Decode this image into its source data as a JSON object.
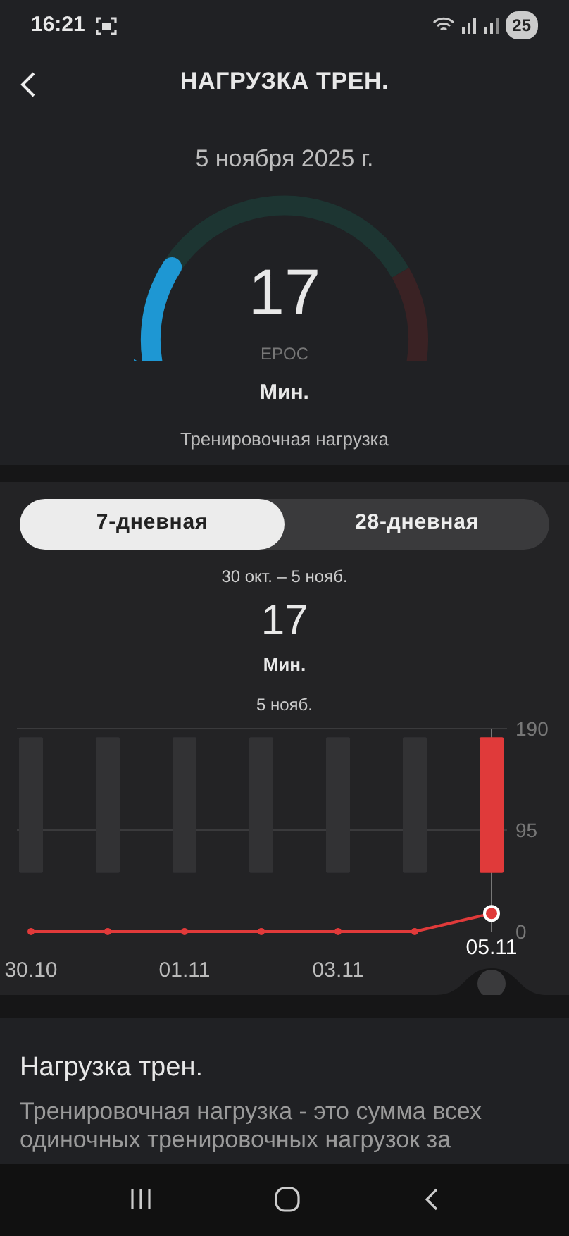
{
  "status_bar": {
    "time": "16:21",
    "battery": "25"
  },
  "header": {
    "title": "НАГРУЗКА ТРЕН."
  },
  "summary": {
    "date": "5 ноября 2025 г.",
    "gauge": {
      "value": "17",
      "unit": "EPOC",
      "level_name": "Мин.",
      "caption": "Тренировочная нагрузка"
    }
  },
  "period_tabs": [
    {
      "label": "7-дневная",
      "selected": true
    },
    {
      "label": "28-дневная",
      "selected": false
    }
  ],
  "period": {
    "range": "30 окт. – 5 нояб.",
    "value": "17",
    "level_name": "Мин.",
    "day": "5 нояб."
  },
  "chart": {
    "chart_data": {
      "type": "line",
      "categories": [
        "30.10",
        null,
        "01.11",
        null,
        "03.11",
        null,
        "05.11"
      ],
      "series": [
        {
          "color": "#e03a3a",
          "marker": "o",
          "values": [
            0,
            0,
            0,
            0,
            0,
            0,
            17
          ]
        }
      ],
      "bands": [
        {
          "axis": "y",
          "from": 55,
          "to": 182
        },
        {
          "axis": "y",
          "from": 55,
          "to": 182
        },
        {
          "axis": "y",
          "from": 55,
          "to": 182
        },
        {
          "axis": "y",
          "from": 55,
          "to": 182
        },
        {
          "axis": "y",
          "from": 55,
          "to": 182
        },
        {
          "axis": "y",
          "from": 55,
          "to": 182
        },
        {
          "axis": "y",
          "from": 55,
          "to": 182
        }
      ],
      "ylim": [
        0,
        190
      ],
      "yticks": [
        0,
        95,
        190
      ]
    }
  },
  "info": {
    "title": "Нагрузка трен.",
    "text": "Тренировочная нагрузка - это сумма всех одиночных тренировочных нагрузок за"
  }
}
